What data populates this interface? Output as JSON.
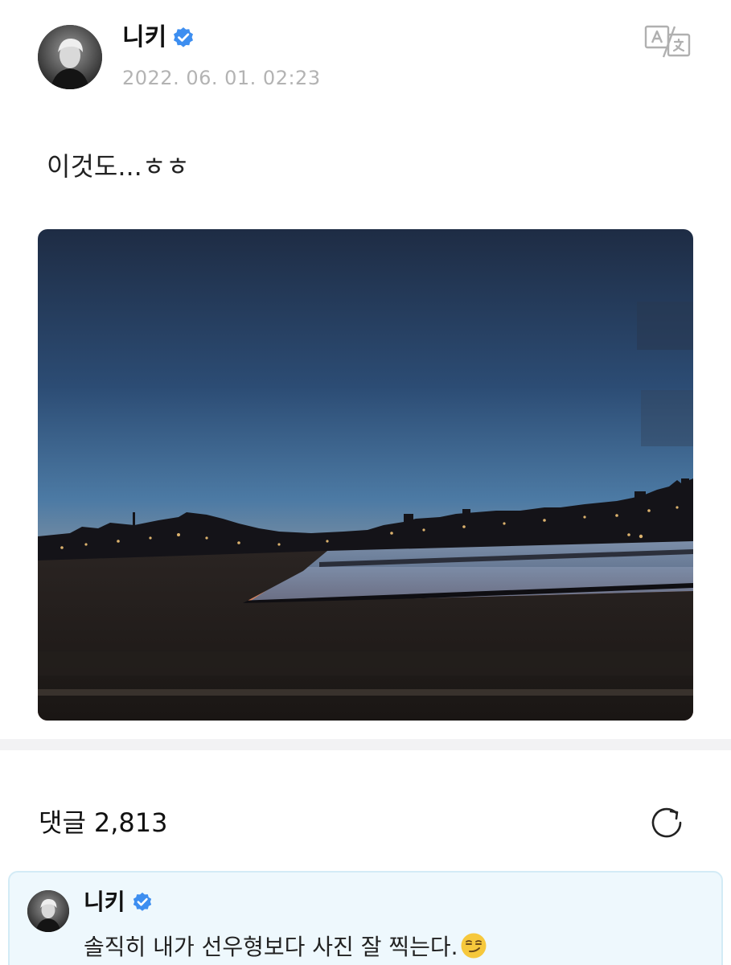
{
  "post": {
    "author": "니키",
    "verified": true,
    "timestamp": "2022. 06. 01. 02:23",
    "text": "이것도...ㅎㅎ",
    "photo": "photo-sunset-river-skyline"
  },
  "comments": {
    "label": "댓글",
    "count": "2,813",
    "pinned": {
      "author": "니키",
      "verified": true,
      "text": "솔직히 내가 선우형보다 사진 잘 찍는다.",
      "emoji": "smirking-face"
    }
  },
  "colors": {
    "verified_badge": "#3d8ef0",
    "timestamp": "#b3b3b3",
    "comment_card_bg": "#eef8fd",
    "comment_card_border": "#d3ebf6",
    "divider": "#f2f2f4"
  },
  "icons": {
    "translate": "translate-icon",
    "refresh": "refresh-icon"
  }
}
